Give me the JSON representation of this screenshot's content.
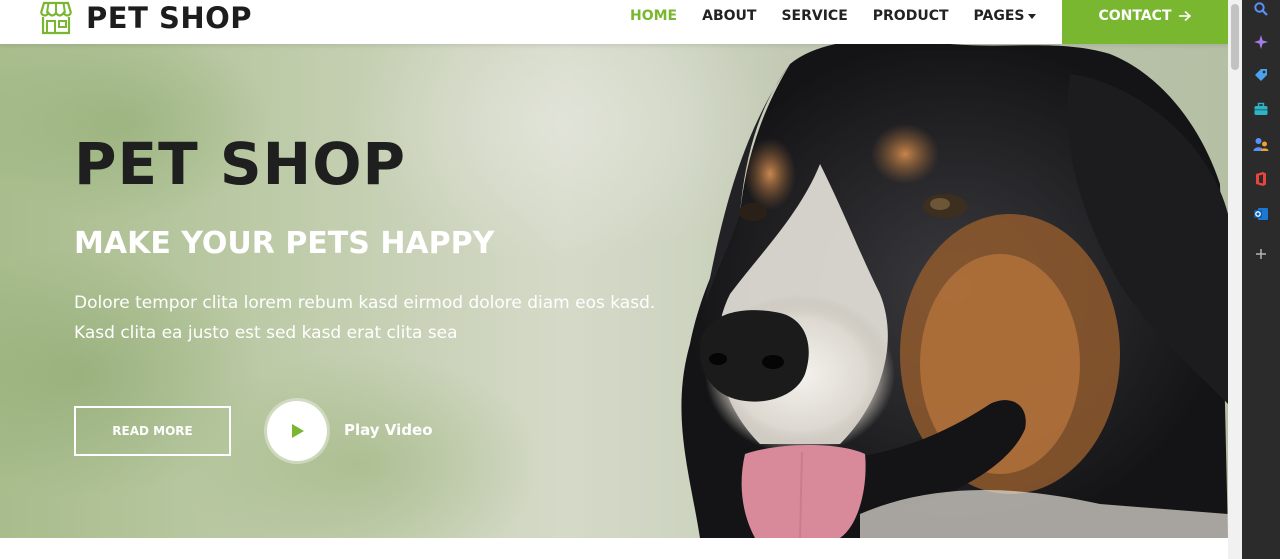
{
  "brand": {
    "name": "PET SHOP",
    "icon": "storefront-icon"
  },
  "nav": {
    "items": [
      {
        "label": "HOME",
        "active": true
      },
      {
        "label": "ABOUT",
        "active": false
      },
      {
        "label": "SERVICE",
        "active": false
      },
      {
        "label": "PRODUCT",
        "active": false
      },
      {
        "label": "PAGES",
        "active": false,
        "dropdown": true
      }
    ],
    "contact_label": "CONTACT",
    "contact_icon": "arrow-right-icon"
  },
  "hero": {
    "title": "PET SHOP",
    "subtitle": "MAKE YOUR PETS HAPPY",
    "text_line1": "Dolore tempor clita lorem rebum kasd eirmod dolore diam eos kasd.",
    "text_line2": "Kasd clita ea justo est sed kasd erat clita sea",
    "read_more_label": "READ MORE",
    "play_label": "Play Video",
    "play_icon": "play-icon"
  },
  "browser_sidebar": {
    "icons": [
      "search-icon",
      "sparkle-icon",
      "tag-icon",
      "briefcase-icon",
      "people-icon",
      "office-icon",
      "outlook-icon",
      "plus-icon"
    ]
  },
  "colors": {
    "accent": "#7ab730",
    "text_dark": "#1f1f1f",
    "sidebar_bg": "#2b2b2b"
  }
}
